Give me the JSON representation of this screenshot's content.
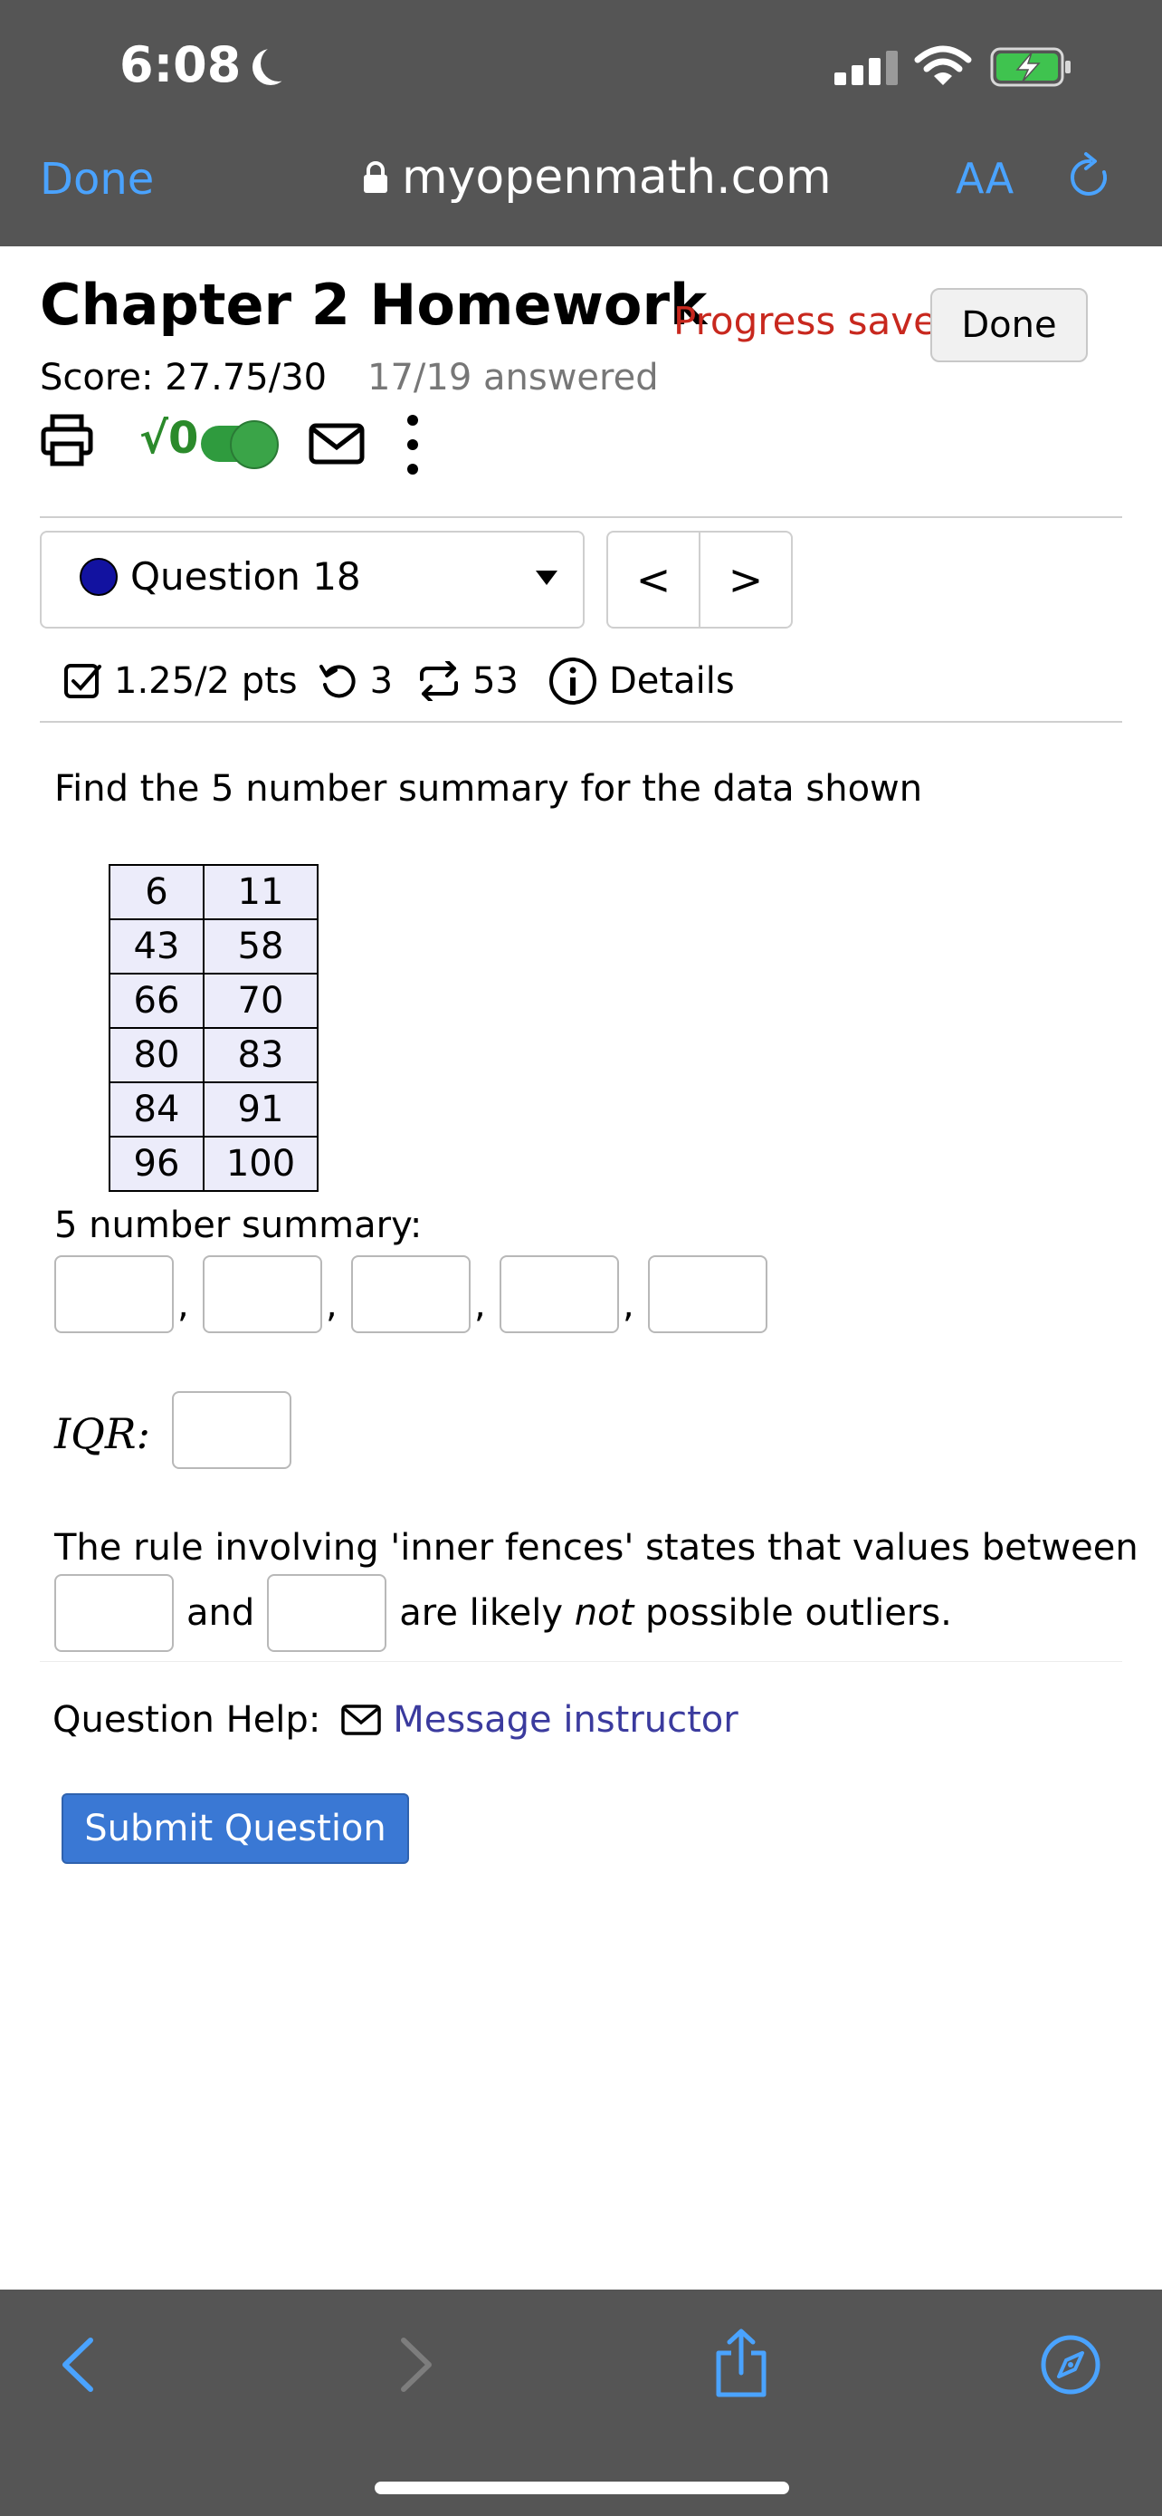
{
  "status_bar": {
    "time": "6:08"
  },
  "browser": {
    "done_label": "Done",
    "url": "myopenmath.com",
    "text_size_label": "AA"
  },
  "header": {
    "title": "Chapter 2 Homework",
    "progress": "Progress saved",
    "done_label": "Done",
    "score": "Score: 27.75/30",
    "answered": "17/19 answered",
    "sqrt_label": "√0"
  },
  "question_nav": {
    "selected": "Question 18",
    "prev": "<",
    "next": ">"
  },
  "question_meta": {
    "points": "1.25/2 pts",
    "retries": "3",
    "versions": "53",
    "details": "Details"
  },
  "question": {
    "prompt": "Find the 5 number summary for the data shown",
    "data_table": [
      [
        "6",
        "11"
      ],
      [
        "43",
        "58"
      ],
      [
        "66",
        "70"
      ],
      [
        "80",
        "83"
      ],
      [
        "84",
        "91"
      ],
      [
        "96",
        "100"
      ]
    ],
    "five_number_label": "5 number summary:",
    "separator": ",",
    "iqr_label": "IQR:",
    "rule_line1": "The rule involving 'inner fences' states that values between",
    "and_label": "and",
    "rule_end_pre": "are likely ",
    "rule_end_em": "not",
    "rule_end_post": " possible outliers."
  },
  "help": {
    "label": "Question Help:",
    "message_link": "Message instructor"
  },
  "submit_label": "Submit Question",
  "colors": {
    "chrome": "#555555",
    "ios_blue": "#4aa3ff",
    "progress_red": "#c8281e",
    "submit_blue": "#3a78d4",
    "toggle_green": "#2f9b3e",
    "table_bg": "#ececfa"
  }
}
